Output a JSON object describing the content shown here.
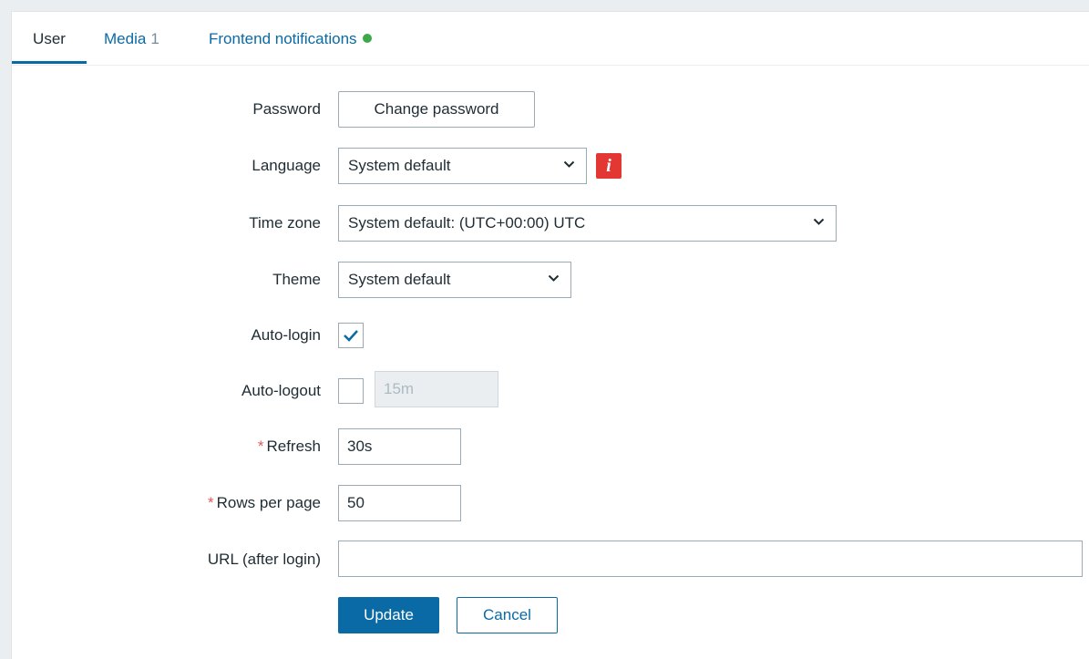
{
  "tabs": [
    {
      "label": "User"
    },
    {
      "label": "Media",
      "count": "1"
    },
    {
      "label": "Frontend notifications",
      "status_color": "#3da848"
    }
  ],
  "form": {
    "password": {
      "label": "Password",
      "button": "Change password"
    },
    "language": {
      "label": "Language",
      "value": "System default",
      "info_icon": "info-icon"
    },
    "timezone": {
      "label": "Time zone",
      "value": "System default: (UTC+00:00) UTC"
    },
    "theme": {
      "label": "Theme",
      "value": "System default"
    },
    "autologin": {
      "label": "Auto-login",
      "checked": true
    },
    "autologout": {
      "label": "Auto-logout",
      "checked": false,
      "value": "15m"
    },
    "refresh": {
      "label": "Refresh",
      "value": "30s",
      "required_mark": "*"
    },
    "rows_per_page": {
      "label": "Rows per page",
      "value": "50",
      "required_mark": "*"
    },
    "url": {
      "label": "URL (after login)",
      "value": ""
    }
  },
  "actions": {
    "update": "Update",
    "cancel": "Cancel"
  },
  "colors": {
    "accent": "#0a6aa6",
    "required": "#e45959",
    "info": "#e33734"
  }
}
